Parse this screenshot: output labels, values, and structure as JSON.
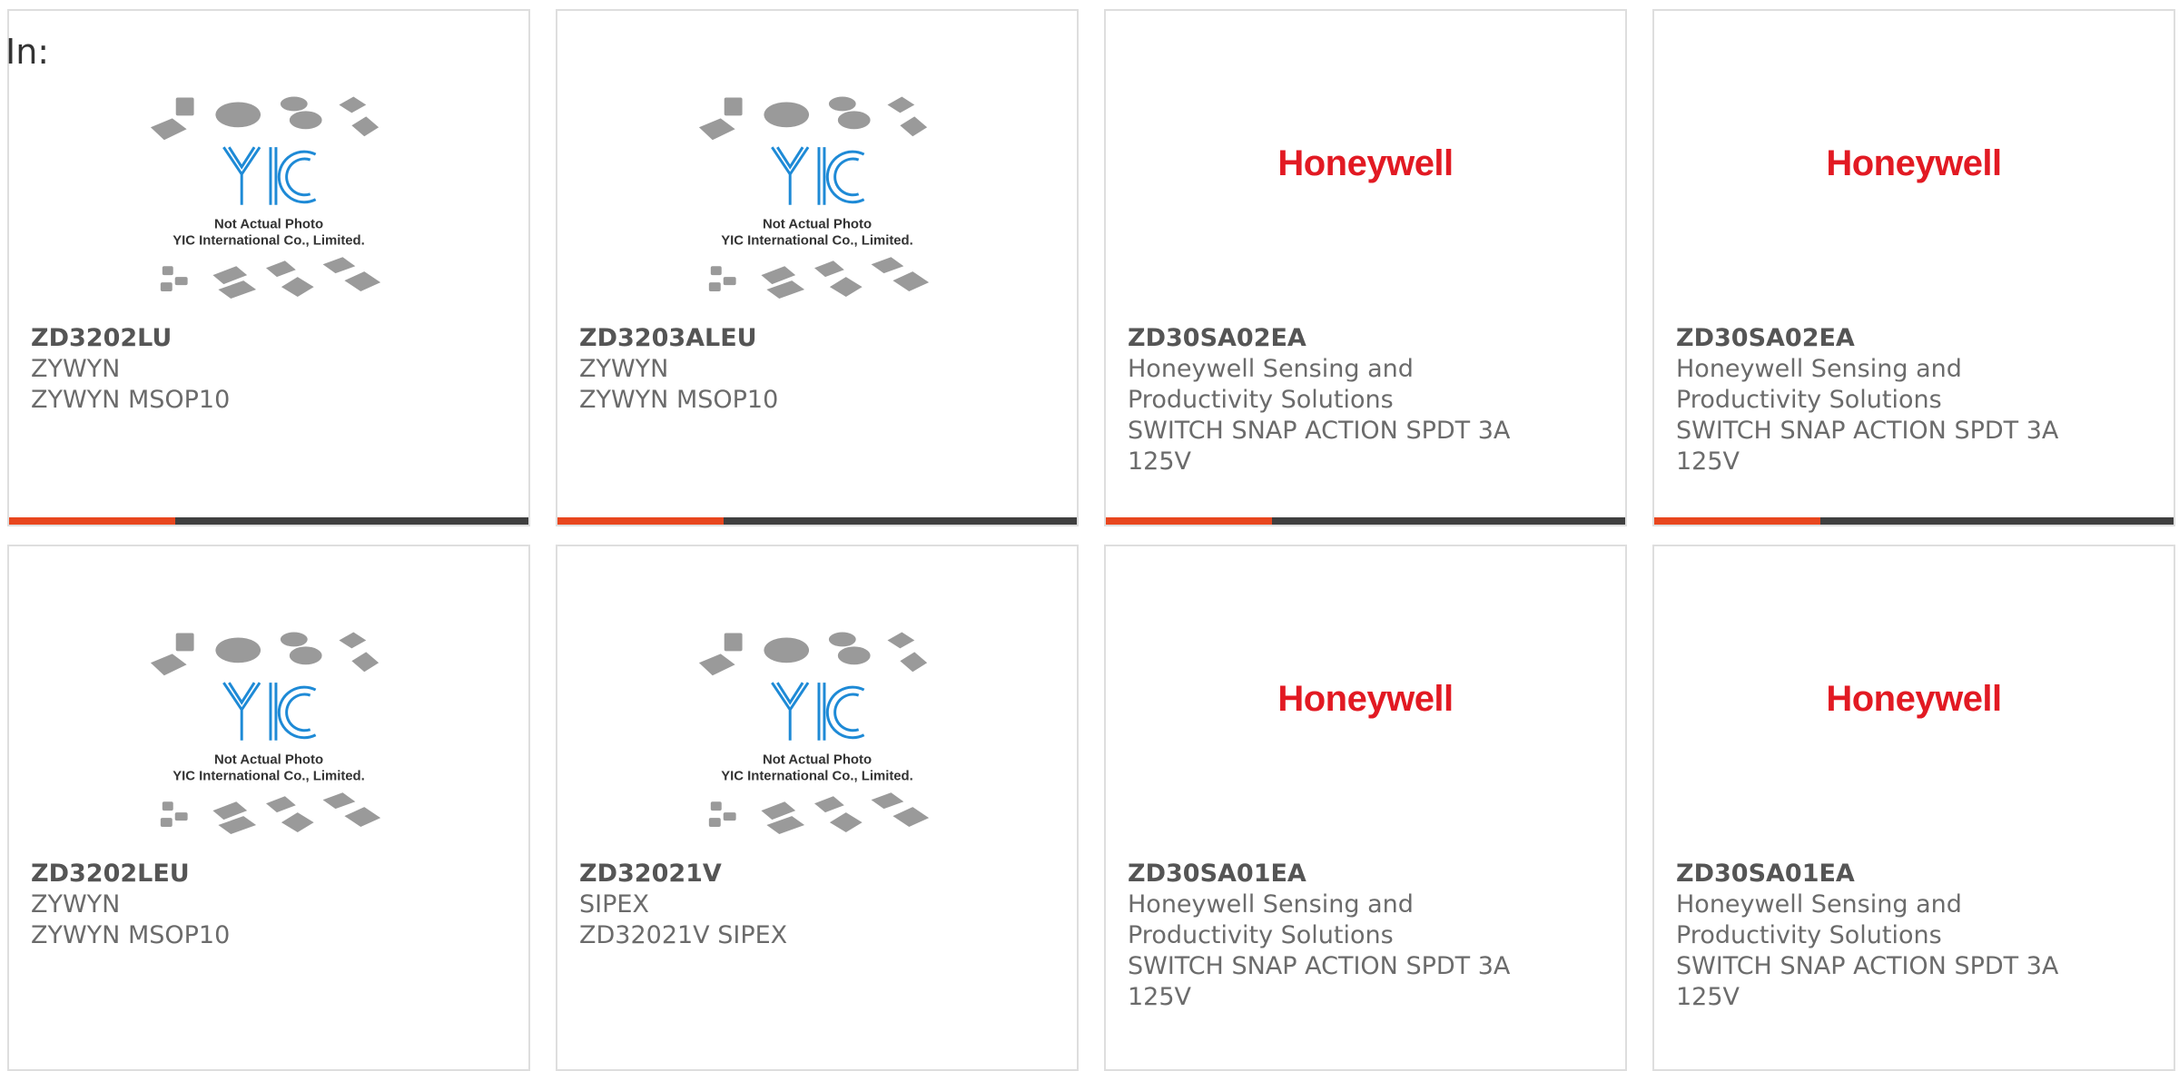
{
  "page_label": "In:",
  "colors": {
    "accent": "#e8461e",
    "track": "#3f3f3f",
    "honeywell_red": "#e21a23",
    "yic_blue": "#1e8ad6"
  },
  "image_texts": {
    "yic_caption_1": "Not Actual Photo",
    "yic_caption_2": "YIC International Co., Limited.",
    "yic_logo": "YIC",
    "honeywell_logo": "Honeywell"
  },
  "products": [
    {
      "image": "yic-placeholder",
      "part_number": "ZD3202LU",
      "manufacturer": "ZYWYN",
      "description": "ZYWYN MSOP10",
      "progress": 0.32
    },
    {
      "image": "yic-placeholder",
      "part_number": "ZD3203ALEU",
      "manufacturer": "ZYWYN",
      "description": "ZYWYN MSOP10",
      "progress": 0.32
    },
    {
      "image": "honeywell-logo",
      "part_number": "ZD30SA02EA",
      "manufacturer": "Honeywell Sensing and Productivity Solutions",
      "description": "SWITCH SNAP ACTION SPDT 3A 125V",
      "progress": 0.32
    },
    {
      "image": "honeywell-logo",
      "part_number": "ZD30SA02EA",
      "manufacturer": "Honeywell Sensing and Productivity Solutions",
      "description": "SWITCH SNAP ACTION SPDT 3A 125V",
      "progress": 0.32
    },
    {
      "image": "yic-placeholder",
      "part_number": "ZD3202LEU",
      "manufacturer": "ZYWYN",
      "description": "ZYWYN MSOP10"
    },
    {
      "image": "yic-placeholder",
      "part_number": "ZD32021V",
      "manufacturer": "SIPEX",
      "description": "ZD32021V SIPEX"
    },
    {
      "image": "honeywell-logo",
      "part_number": "ZD30SA01EA",
      "manufacturer": "Honeywell Sensing and Productivity Solutions",
      "description": "SWITCH SNAP ACTION SPDT 3A 125V"
    },
    {
      "image": "honeywell-logo",
      "part_number": "ZD30SA01EA",
      "manufacturer": "Honeywell Sensing and Productivity Solutions",
      "description": "SWITCH SNAP ACTION SPDT 3A 125V"
    }
  ]
}
